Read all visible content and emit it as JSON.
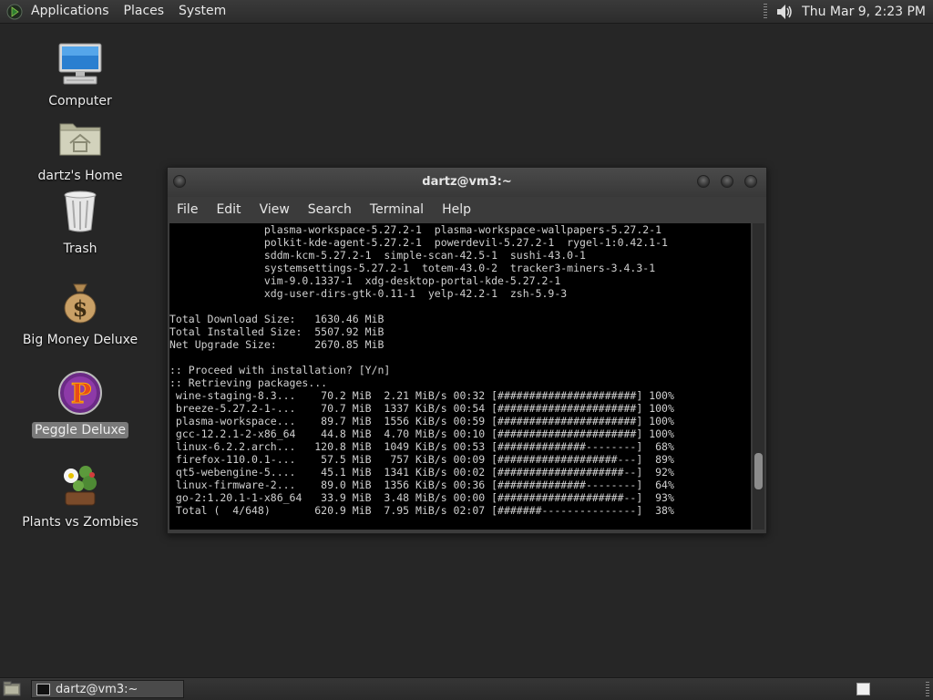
{
  "top_panel": {
    "menus": [
      "Applications",
      "Places",
      "System"
    ],
    "clock": "Thu Mar  9,  2:23 PM"
  },
  "desktop_icons": [
    {
      "label": "Computer",
      "icon": "computer-icon"
    },
    {
      "label": "dartz's Home",
      "icon": "home-folder-icon"
    },
    {
      "label": "Trash",
      "icon": "trash-icon"
    },
    {
      "label": "Big Money Deluxe",
      "icon": "money-bag-icon"
    },
    {
      "label": "Peggle Deluxe",
      "icon": "peggle-icon",
      "selected": true
    },
    {
      "label": "Plants vs Zombies",
      "icon": "plants-vs-zombies-icon"
    }
  ],
  "terminal": {
    "title": "dartz@vm3:~",
    "menus": [
      "File",
      "Edit",
      "View",
      "Search",
      "Terminal",
      "Help"
    ],
    "lines": [
      "               plasma-workspace-5.27.2-1  plasma-workspace-wallpapers-5.27.2-1",
      "               polkit-kde-agent-5.27.2-1  powerdevil-5.27.2-1  rygel-1:0.42.1-1",
      "               sddm-kcm-5.27.2-1  simple-scan-42.5-1  sushi-43.0-1",
      "               systemsettings-5.27.2-1  totem-43.0-2  tracker3-miners-3.4.3-1",
      "               vim-9.0.1337-1  xdg-desktop-portal-kde-5.27.2-1",
      "               xdg-user-dirs-gtk-0.11-1  yelp-42.2-1  zsh-5.9-3",
      "",
      "Total Download Size:   1630.46 MiB",
      "Total Installed Size:  5507.92 MiB",
      "Net Upgrade Size:      2670.85 MiB",
      "",
      ":: Proceed with installation? [Y/n]",
      ":: Retrieving packages...",
      " wine-staging-8.3...    70.2 MiB  2.21 MiB/s 00:32 [######################] 100%",
      " breeze-5.27.2-1-...    70.7 MiB  1337 KiB/s 00:54 [######################] 100%",
      " plasma-workspace...    89.7 MiB  1556 KiB/s 00:59 [######################] 100%",
      " gcc-12.2.1-2-x86_64    44.8 MiB  4.70 MiB/s 00:10 [######################] 100%",
      " linux-6.2.2.arch...   120.8 MiB  1049 KiB/s 00:53 [##############--------]  68%",
      " firefox-110.0.1-...    57.5 MiB   757 KiB/s 00:09 [###################---]  89%",
      " qt5-webengine-5....    45.1 MiB  1341 KiB/s 00:02 [####################--]  92%",
      " linux-firmware-2...    89.0 MiB  1356 KiB/s 00:36 [##############--------]  64%",
      " go-2:1.20.1-1-x86_64   33.9 MiB  3.48 MiB/s 00:00 [####################--]  93%",
      " Total (  4/648)       620.9 MiB  7.95 MiB/s 02:07 [#######---------------]  38%"
    ],
    "scroll_position": 0.85,
    "scroll_visible_fraction": 0.12
  },
  "bottom_panel": {
    "task_label": "dartz@vm3:~"
  }
}
